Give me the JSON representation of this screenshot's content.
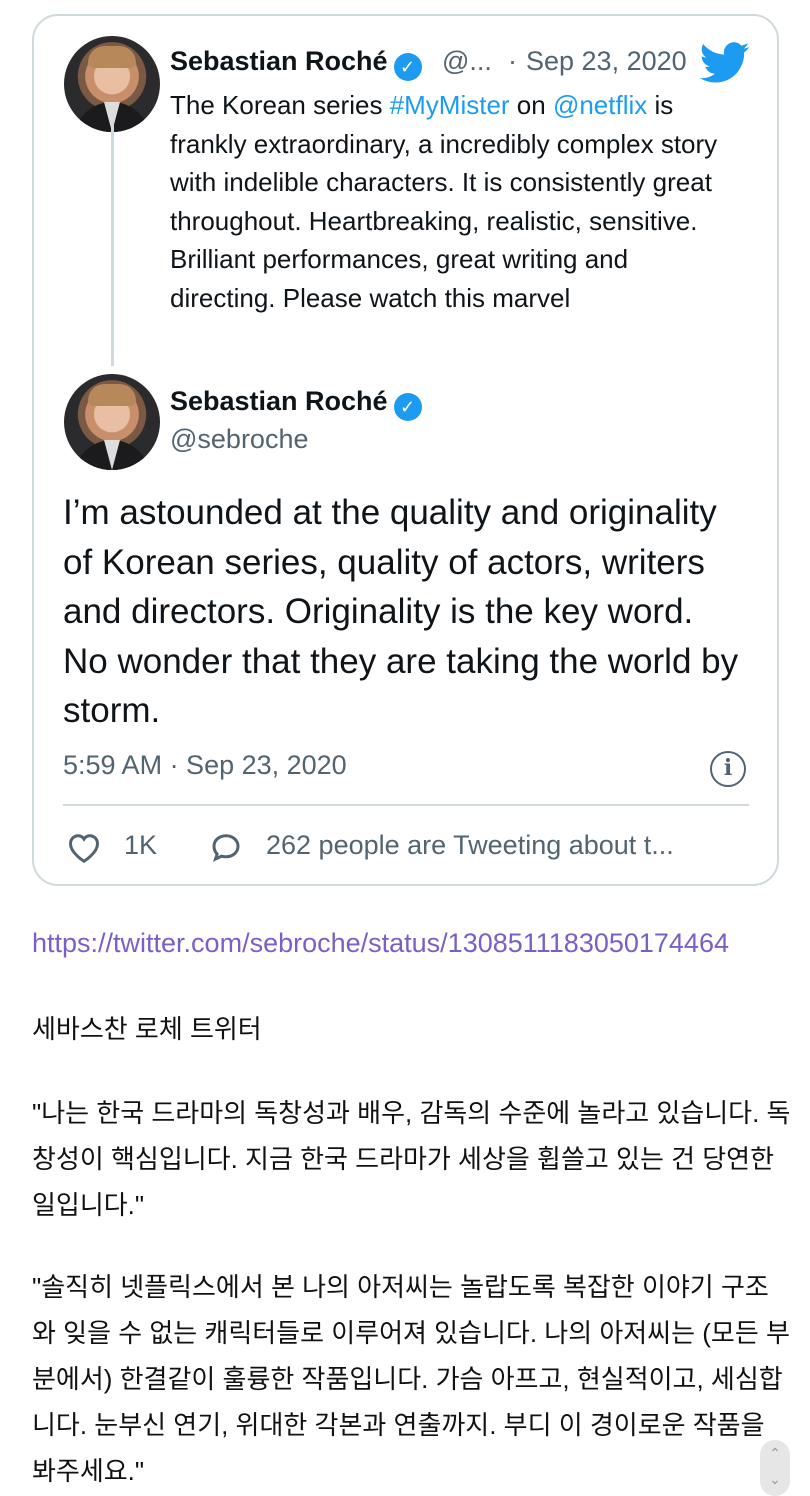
{
  "quoted_tweet": {
    "name": "Sebastian Roché",
    "handle": "@...",
    "separator": "·",
    "date": "Sep 23, 2020",
    "text_parts": {
      "before_hashtag": "The Korean series ",
      "hashtag": "#MyMister",
      "middle": " on ",
      "mention": "@netflix",
      "after": " is frankly extraordinary,  a incredibly complex story with indelible characters. It is consistently great throughout. Heartbreaking, realistic, sensitive. Brilliant performances, great writing and directing. Please watch this marvel"
    }
  },
  "main_tweet": {
    "name": "Sebastian Roché",
    "handle": "@sebroche",
    "text": "I’m astounded at the quality and originality of Korean series,  quality of actors, writers and directors. Originality is the key word. No wonder that they are taking the world by storm.",
    "timestamp": "5:59 AM · Sep 23, 2020",
    "info_icon": "i",
    "likes": "1K",
    "talk": "262 people are Tweeting about t..."
  },
  "post": {
    "url": "https://twitter.com/sebroche/status/1308511183050174464",
    "caption": "세바스찬 로체 트위터",
    "quote1": "\"나는 한국 드라마의 독창성과 배우, 감독의 수준에 놀라고 있습니다. 독창성이 핵심입니다. 지금 한국 드라마가 세상을 휩쓸고 있는 건 당연한 일입니다.\"",
    "quote2": "\"솔직히 넷플릭스에서 본 나의 아저씨는 놀랍도록 복잡한 이야기 구조와 잊을 수 없는 캐릭터들로 이루어져 있습니다. 나의 아저씨는 (모든 부분에서) 한결같이 훌륭한 작품입니다. 가슴 아프고, 현실적이고, 세심합니다. 눈부신 연기, 위대한 각본과 연출까지. 부디 이 경이로운 작품을 봐주세요.\""
  },
  "colors": {
    "accent": "#1d9bf0",
    "muted": "#536471",
    "border": "#cfd9de",
    "url": "#7a5fc6"
  }
}
